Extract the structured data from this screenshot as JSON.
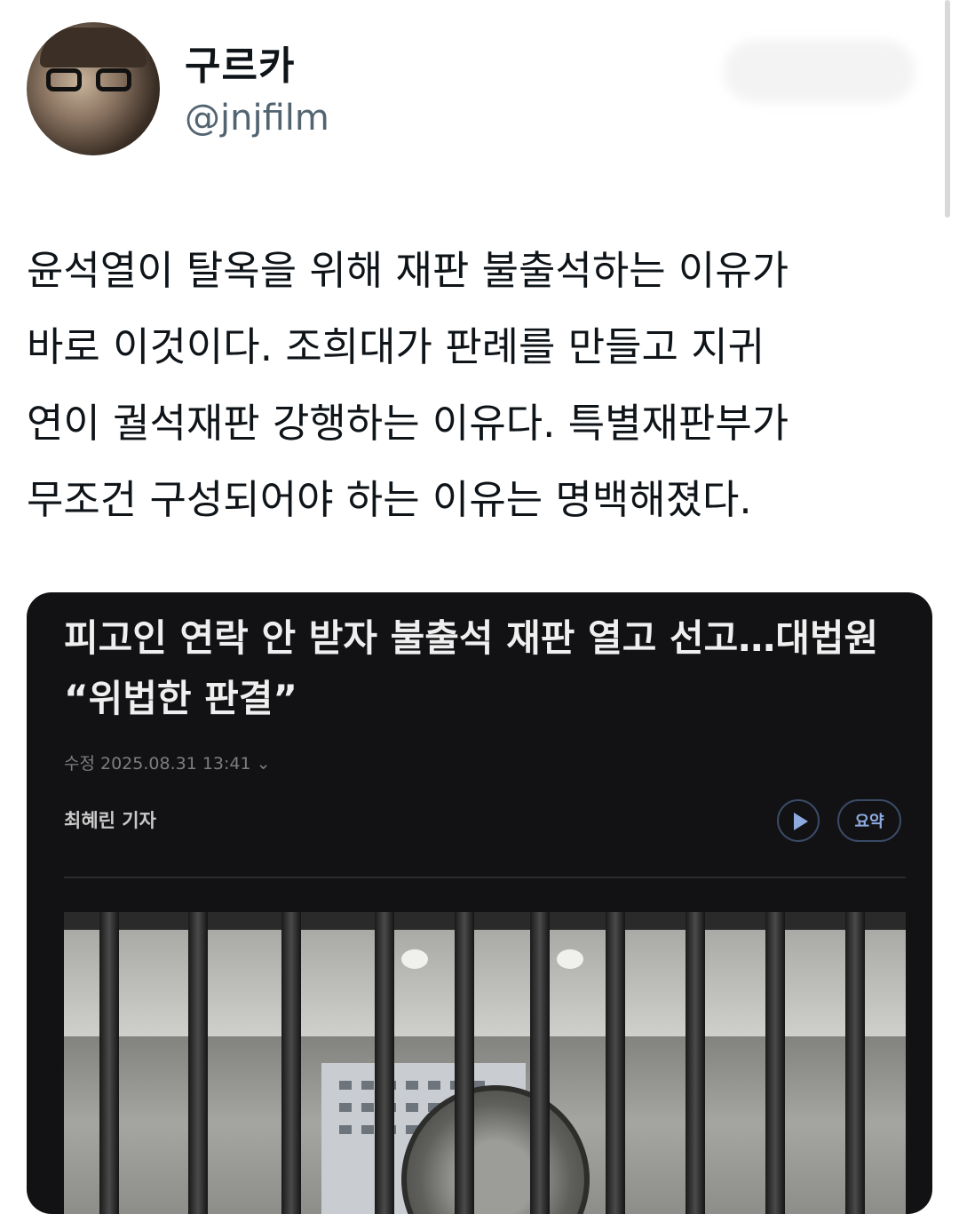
{
  "author": {
    "display_name": "구르카",
    "handle": "@jnjfilm"
  },
  "tweet": {
    "text": "윤석열이 탈옥을 위해 재판 불출석하는 이유가\n바로 이것이다. 조희대가 판례를 만들고 지귀\n연이 궐석재판 강행하는 이유다. 특별재판부가\n무조건 구성되어야 하는 이유는 명백해졌다."
  },
  "article_card": {
    "headline": "피고인 연락 안 받자 불출석 재판 열고 선고…대법원 “위법한 판결”",
    "dateline": "수정 2025.08.31 13:41 ⌄",
    "byline": "최혜린 기자",
    "summary_label": "요약"
  }
}
